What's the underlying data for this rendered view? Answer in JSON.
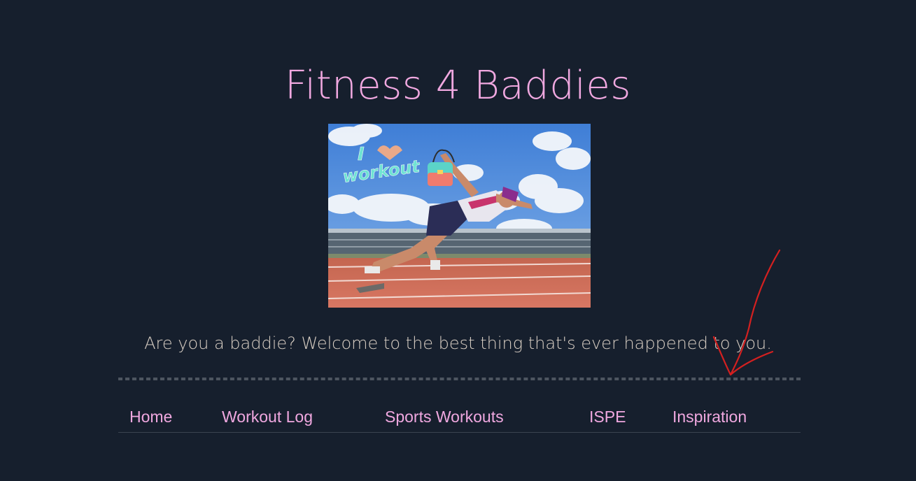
{
  "header": {
    "title": "Fitness 4 Baddies"
  },
  "hero": {
    "sticker_line1": "I",
    "sticker_line2": "workout"
  },
  "tagline": "Are you a baddie? Welcome to the best thing that's ever happened to you.",
  "nav": {
    "items": [
      {
        "label": "Home"
      },
      {
        "label": "Workout Log"
      },
      {
        "label": "Sports Workouts"
      },
      {
        "label": "ISPE"
      },
      {
        "label": "Inspiration"
      }
    ]
  },
  "colors": {
    "background": "#161f2d",
    "accent_pink": "#f0a8e0",
    "tagline_text": "#d9cfc4",
    "annotation_red": "#d42020"
  }
}
